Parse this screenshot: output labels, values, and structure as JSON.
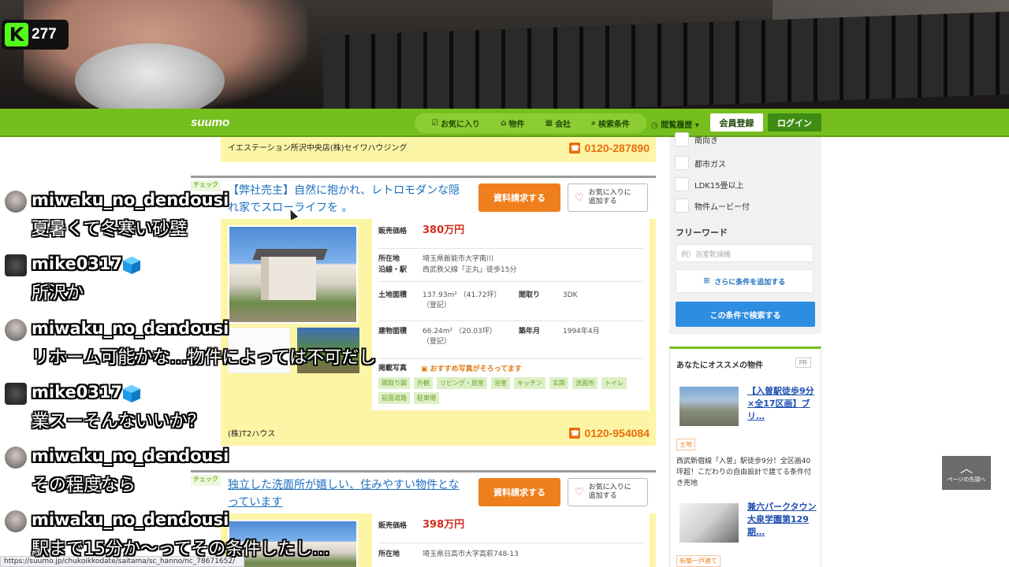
{
  "kick": {
    "viewer_count": "277",
    "logo": "K"
  },
  "header": {
    "logo": "suumo",
    "nav": [
      {
        "icon": "checkbox-icon",
        "label": "お気に入り"
      },
      {
        "icon": "house-icon",
        "label": "物件"
      },
      {
        "icon": "building-icon",
        "label": "会社"
      },
      {
        "icon": "search-icon",
        "label": "検索条件"
      }
    ],
    "history": "閲覧履歴",
    "register": "会員登録",
    "login": "ログイン"
  },
  "prev_listing": {
    "company": "イエステーション所沢中央店(株)セイワハウジング",
    "tel": "0120-287890"
  },
  "listings": [
    {
      "check": "チェック",
      "title": "【弊社売主】自然に抱かれ、レトロモダンな隠れ家でスローライフを 。",
      "doc_button": "資料請求する",
      "fav_button": "お気に入りに追加する",
      "price_label": "販売価格",
      "price": "380万円",
      "location_label": "所在地",
      "location": "埼玉県飯能市大字南川",
      "station_label": "沿線・駅",
      "station": "西武秩父線「正丸」徒歩15分",
      "land_label": "土地面積",
      "land": "137.93m² （41.72坪） （登記）",
      "layout_label": "間取り",
      "layout": "3DK",
      "building_label": "建物面積",
      "building": "66.24m² （20.03坪） （登記）",
      "built_label": "築年月",
      "built": "1994年4月",
      "photos_label": "掲載写真",
      "recommend": "おすすめ写真がそろってます",
      "tags": [
        "間取り図",
        "外観",
        "リビング・居室",
        "浴室",
        "キッチン",
        "玄関",
        "洗面所",
        "トイレ",
        "前面道路",
        "駐車場"
      ],
      "company": "(株)T2ハウス",
      "tel": "0120-954084"
    },
    {
      "check": "チェック",
      "title": "独立した洗面所が嬉しい、住みやすい物件となっています",
      "doc_button": "資料請求する",
      "fav_button": "お気に入りに追加する",
      "price_label": "販売価格",
      "price": "398万円",
      "location_label": "所在地",
      "location": "埼玉県日高市大字高萩748-13"
    }
  ],
  "sidebar": {
    "checkboxes": [
      "南向き",
      "都市ガス",
      "LDK15畳以上",
      "物件ムービー付"
    ],
    "freeword_title": "フリーワード",
    "freeword_placeholder": "例）浴室乾燥機",
    "add_condition": "さらに条件を追加する",
    "search_button": "この条件で検索する",
    "reco_title": "あなたにオススメの物件",
    "pr": "PR",
    "reco_items": [
      {
        "title": "【入曽駅徒歩9分×全17区画】ブリ…",
        "tag": "土地",
        "desc": "西武新宿線「入曽」駅徒歩9分！全区画40坪超！こだわりの自由設計で建てる条件付き売地"
      },
      {
        "title": "兼六パークタウン大泉学園第129期…",
        "tag": "新築一戸建て"
      }
    ]
  },
  "to_top": {
    "label": "ページの先頭へ"
  },
  "status_url": "https://suumo.jp/chukoikkodate/saitama/sc_hanno/nc_78671652/",
  "chat": [
    {
      "user": "miwaku_no_dendousi",
      "avatar": "gray",
      "badge": false,
      "text": "夏暑くて冬寒い砂壁"
    },
    {
      "user": "mike0317",
      "avatar": "robot",
      "badge": true,
      "text": "所沢か"
    },
    {
      "user": "miwaku_no_dendousi",
      "avatar": "gray",
      "badge": false,
      "text": "リホーム可能かな…物件によっては不可だし"
    },
    {
      "user": "mike0317",
      "avatar": "robot",
      "badge": true,
      "text": "業スーそんないいか？"
    },
    {
      "user": "miwaku_no_dendousi",
      "avatar": "gray",
      "badge": false,
      "text": "その程度なら"
    },
    {
      "user": "miwaku_no_dendousi",
      "avatar": "gray",
      "badge": false,
      "text": "駅まで15分か～ってその条件したし…"
    }
  ],
  "colors": {
    "suumo_green": "#76be1e",
    "kick_green": "#53fc18",
    "price_red": "#d22d1f",
    "tel_orange": "#e86f0e",
    "link_blue": "#1d6fbf"
  }
}
